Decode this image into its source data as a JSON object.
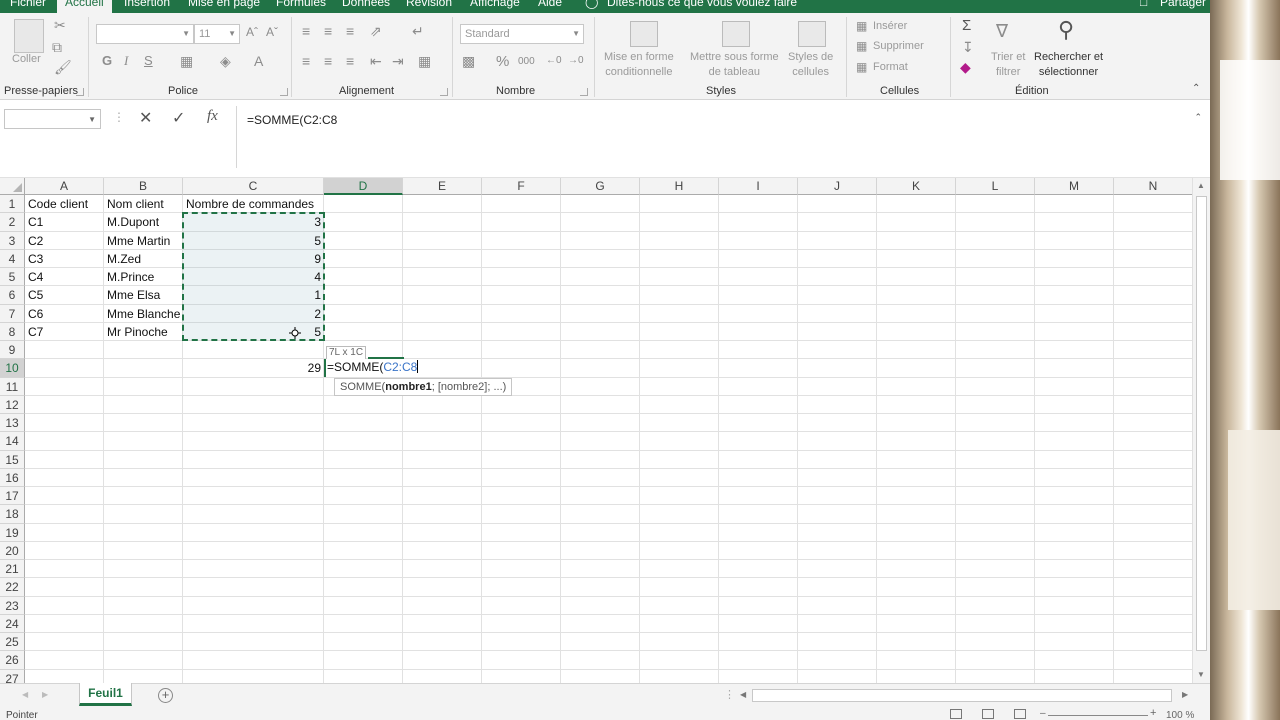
{
  "ribbon_tabs": [
    "Fichier",
    "Accueil",
    "Insertion",
    "Mise en page",
    "Formules",
    "Données",
    "Révision",
    "Affichage",
    "Aide"
  ],
  "active_tab": "Accueil",
  "tell_me": "Dites-nous ce que vous voulez faire",
  "share": "Partager",
  "clipboard": {
    "paste": "Coller",
    "label": "Presse-papiers"
  },
  "font": {
    "size": "11",
    "bold": "G",
    "italic": "I",
    "underline": "S",
    "label": "Police"
  },
  "alignment": {
    "label": "Alignement"
  },
  "number": {
    "format": "Standard",
    "percent": "%",
    "thousands": "000",
    "label": "Nombre"
  },
  "styles": {
    "conditional": [
      "Mise en forme",
      "conditionnelle"
    ],
    "as_table": [
      "Mettre sous forme",
      "de tableau"
    ],
    "cell_styles": [
      "Styles de",
      "cellules"
    ],
    "label": "Styles"
  },
  "cells": {
    "insert": "Insérer",
    "delete": "Supprimer",
    "format": "Format",
    "label": "Cellules"
  },
  "editing": {
    "sort": [
      "Trier et",
      "filtrer"
    ],
    "find": [
      "Rechercher et",
      "sélectionner"
    ],
    "label": "Édition"
  },
  "formula_bar": {
    "name_box": "",
    "content": "=SOMME(C2:C8",
    "fx": "fx"
  },
  "columns": [
    "A",
    "B",
    "C",
    "D",
    "E",
    "F",
    "G",
    "H",
    "I",
    "J",
    "K",
    "L",
    "M",
    "N"
  ],
  "selected_column": "D",
  "rows": [
    "1",
    "2",
    "3",
    "4",
    "5",
    "6",
    "7",
    "8",
    "9",
    "10",
    "11",
    "12",
    "13",
    "14",
    "15",
    "16",
    "17",
    "18",
    "19",
    "20",
    "21",
    "22",
    "23",
    "24",
    "25",
    "26",
    "27"
  ],
  "selected_row": "10",
  "header_row": {
    "a": "Code client",
    "b": "Nom client",
    "c": "Nombre de commandes"
  },
  "data_rows": [
    {
      "a": "C1",
      "b": "M.Dupont",
      "c": "3"
    },
    {
      "a": "C2",
      "b": "Mme Martin",
      "c": "5"
    },
    {
      "a": "C3",
      "b": "M.Zed",
      "c": "9"
    },
    {
      "a": "C4",
      "b": "M.Prince",
      "c": "4"
    },
    {
      "a": "C5",
      "b": "Mme Elsa",
      "c": "1"
    },
    {
      "a": "C6",
      "b": "Mme Blanche",
      "c": "2"
    },
    {
      "a": "C7",
      "b": "Mr Pinoche",
      "c": "5"
    }
  ],
  "c10_value": "29",
  "range_size_tip": "7L x 1C",
  "edit_cell": {
    "prefix": "=SOMME(",
    "ref": "C2:C8"
  },
  "syntax_tip": {
    "fn": "SOMME(",
    "arg1": "nombre1",
    "rest": "; [nombre2]; ...)"
  },
  "sheet": {
    "name": "Feuil1"
  },
  "status": {
    "mode": "Pointer",
    "zoom": "100 %"
  },
  "colors": {
    "accent": "#217346",
    "ref_blue": "#3a74c8"
  }
}
